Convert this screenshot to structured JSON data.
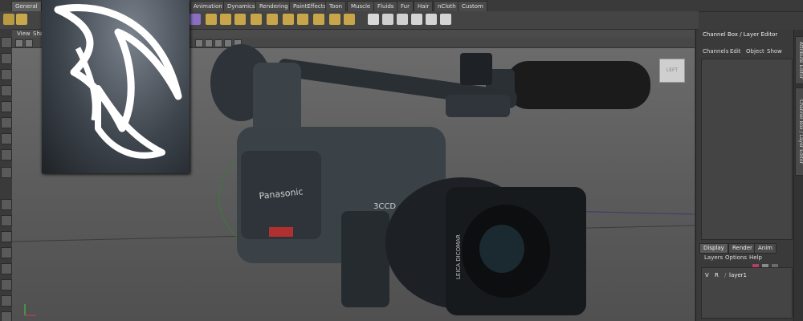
{
  "shelf_tabs": [
    "General",
    "Animation",
    "Dynamics",
    "Rendering",
    "PaintEffects",
    "Toon",
    "Muscle",
    "Fluids",
    "Fur",
    "Hair",
    "nCloth",
    "Custom"
  ],
  "viewport_menu": [
    "View",
    "Sha"
  ],
  "channel_box": {
    "title": "Channel Box / Layer Editor",
    "menu": [
      "Channels",
      "Edit",
      "Object",
      "Show"
    ],
    "layer_tabs": [
      "Display",
      "Render",
      "Anim"
    ],
    "layer_menu": [
      "Layers",
      "Options",
      "Help"
    ],
    "layer_row": {
      "v": "V",
      "r": "R",
      "name": "layer1"
    }
  },
  "side_tabs": [
    "Attribute Editor",
    "Channel Box / Layer Editor"
  ],
  "viewcube_label": "LEFT",
  "camera_labels": {
    "brand": "Panasonic",
    "model": "3CCD",
    "lens": "LEICA DICOMAR"
  },
  "colors": {
    "accent_orange": "#e0a020",
    "panel": "#3a3a3a",
    "viewport": "#666666"
  }
}
